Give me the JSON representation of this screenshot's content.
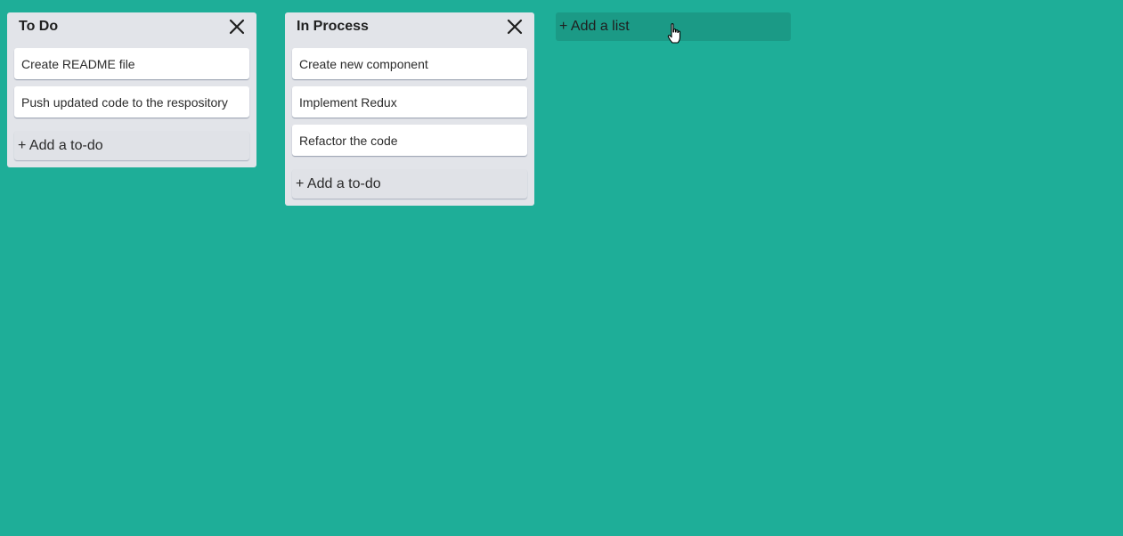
{
  "board": {
    "lists": [
      {
        "title": "To Do",
        "close_icon": "close-icon",
        "cards": [
          "Create README file",
          "Push updated code to the respository"
        ],
        "add_label": "+ Add a to-do"
      },
      {
        "title": "In Process",
        "close_icon": "close-icon",
        "cards": [
          "Create new component",
          "Implement Redux",
          "Refactor the code"
        ],
        "add_label": "+ Add a to-do"
      }
    ],
    "add_list_label": "+ Add a list"
  },
  "colors": {
    "background": "#1eae98",
    "list_background": "#e2e4e9",
    "add_list_background": "#1b9a86",
    "card_background": "#ffffff"
  },
  "cursor_icon": "hand-pointer-icon"
}
